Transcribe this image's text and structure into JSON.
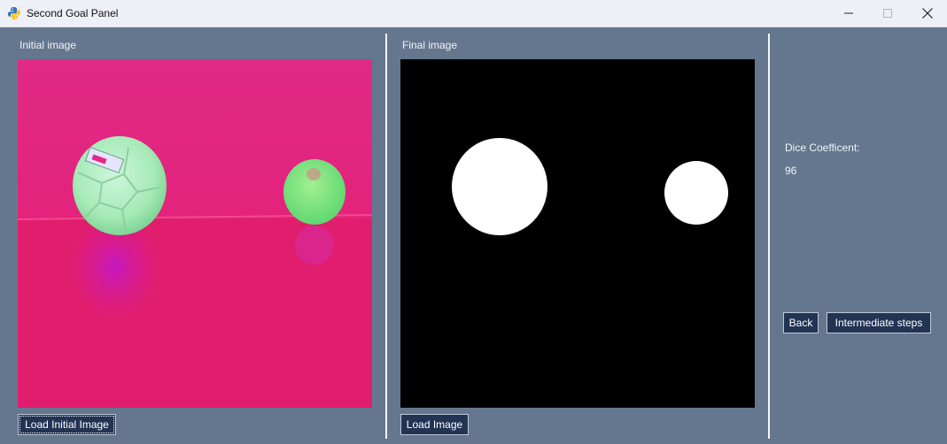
{
  "window": {
    "title": "Second Goal Panel",
    "controls": [
      "minimize",
      "maximize",
      "close"
    ]
  },
  "left_panel": {
    "label": "Initial image",
    "button_label": "Load Initial Image"
  },
  "middle_panel": {
    "label": "Final image",
    "button_label": "Load Image"
  },
  "right_panel": {
    "metric_label": "Dice Coefficent:",
    "metric_value": "96",
    "back_label": "Back",
    "steps_label": "Intermediate steps"
  },
  "colors": {
    "background": "#64778e",
    "button": "#223354",
    "magenta_bg": "#e8207a",
    "ball_green": "#a5ecb4"
  }
}
